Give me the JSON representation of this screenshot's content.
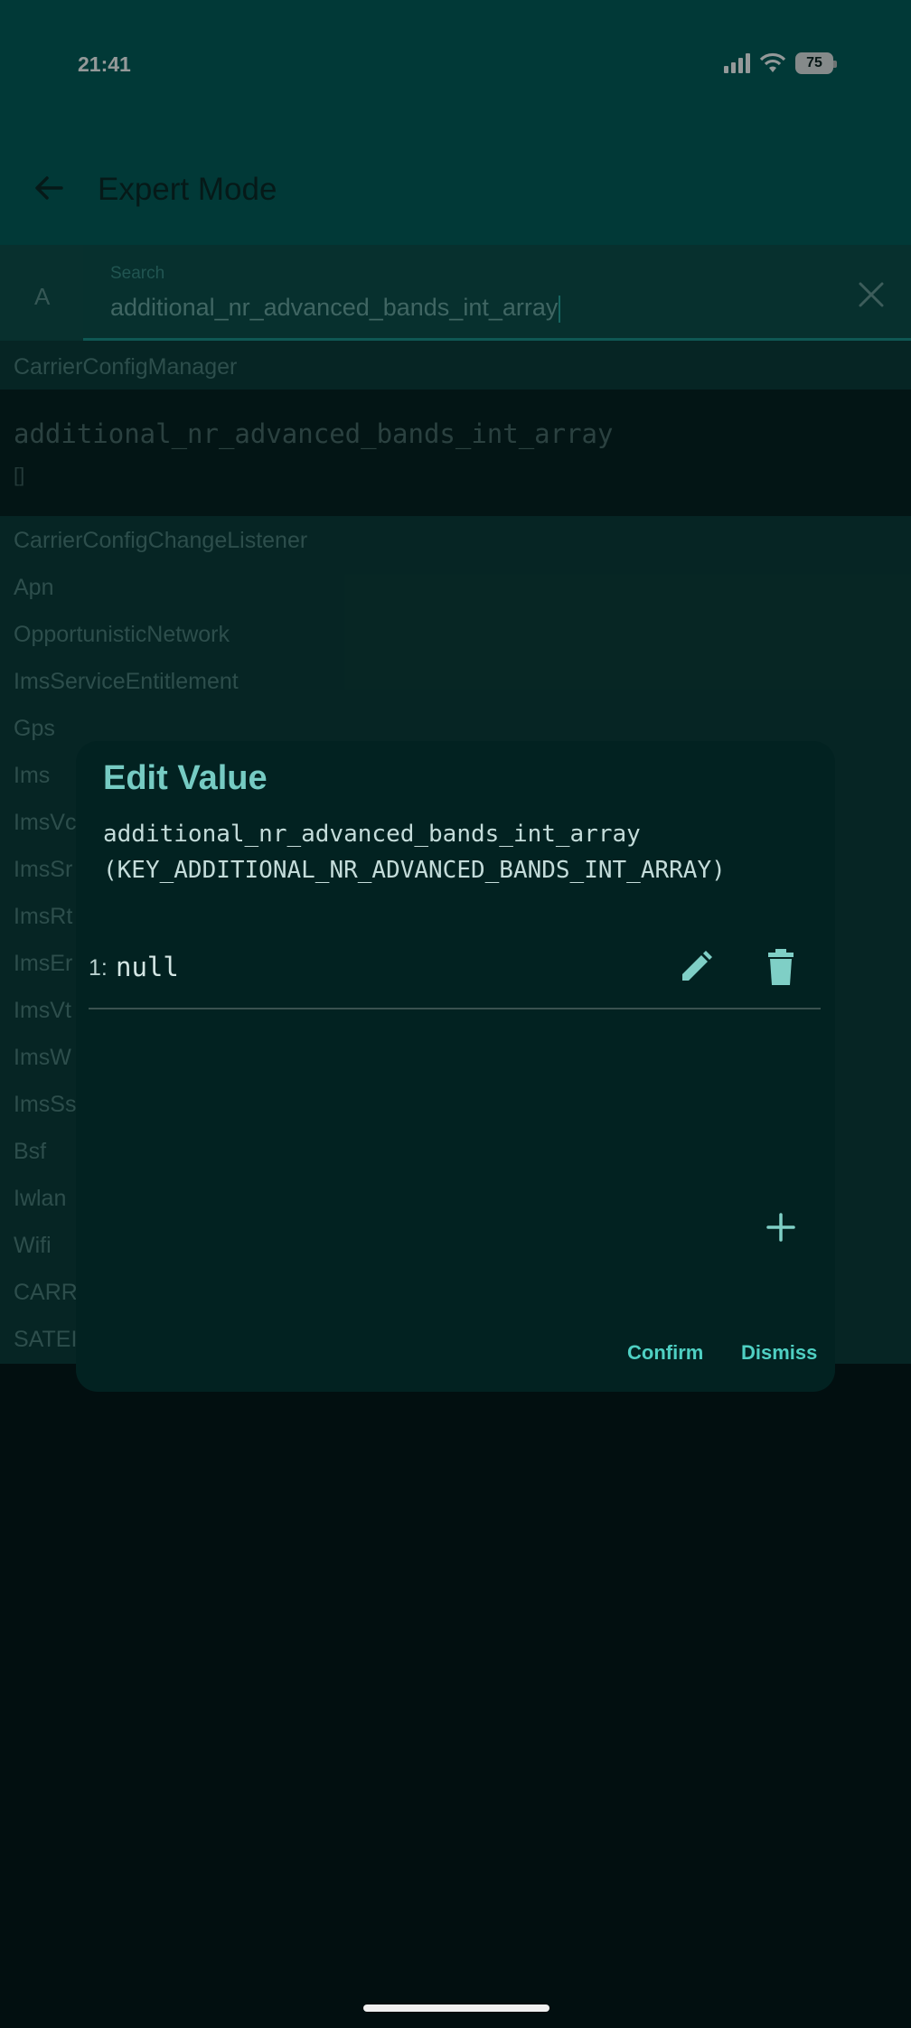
{
  "status_bar": {
    "time": "21:41",
    "battery": "75"
  },
  "app_bar": {
    "title": "Expert Mode"
  },
  "search": {
    "prefix": "A",
    "label": "Search",
    "value": "additional_nr_advanced_bands_int_array"
  },
  "list": {
    "current_section": "CarrierConfigManager",
    "highlighted": {
      "key": "additional_nr_advanced_bands_int_array",
      "value": "[]"
    },
    "sections": [
      "CarrierConfigChangeListener",
      "Apn",
      "OpportunisticNetwork",
      "ImsServiceEntitlement",
      "Gps",
      "Ims",
      "ImsVc",
      "ImsSr",
      "ImsRt",
      "ImsEr",
      "ImsVt",
      "ImsW",
      "ImsSs",
      "Bsf",
      "Iwlan",
      "Wifi",
      "CARR",
      "SATEI"
    ]
  },
  "dialog": {
    "title": "Edit Value",
    "key_line1": "additional_nr_advanced_bands_int_array",
    "key_line2": "(KEY_ADDITIONAL_NR_ADVANCED_BANDS_INT_ARRAY)",
    "items": [
      {
        "index": "1:",
        "value": "null"
      }
    ],
    "confirm_label": "Confirm",
    "dismiss_label": "Dismiss",
    "icons": {
      "edit": "pencil-icon",
      "delete": "trash-icon",
      "add": "plus-icon"
    }
  },
  "colors": {
    "app_bar": "#025a56",
    "accent": "#4fd0c3",
    "dialog_bg": "#022221"
  }
}
